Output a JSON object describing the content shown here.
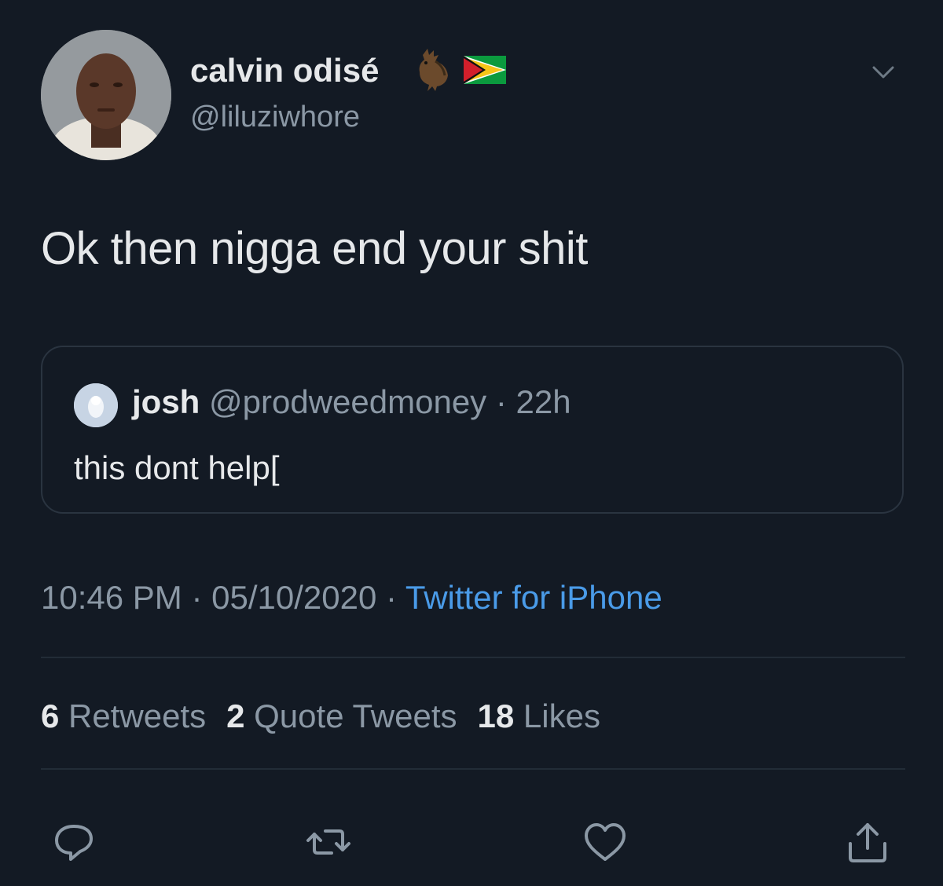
{
  "author": {
    "display_name": "calvin odisé",
    "handle": "@liluziwhore"
  },
  "tweet": {
    "text": "Ok then nigga end your shit"
  },
  "quoted_tweet": {
    "name": "josh",
    "meta": "@prodweedmoney · 22h",
    "text": "this dont help["
  },
  "timestamp": {
    "time_date": "10:46 PM · 05/10/2020 · ",
    "source": "Twitter for iPhone"
  },
  "stats": {
    "retweets_count": "6",
    "retweets_label": "Retweets",
    "quote_count": "2",
    "quote_label": "Quote Tweets",
    "likes_count": "18",
    "likes_label": "Likes"
  },
  "icons": {
    "reply": "reply-icon",
    "retweet": "retweet-icon",
    "like": "heart-icon",
    "share": "share-icon",
    "caret": "chevron-down-icon"
  },
  "colors": {
    "background": "#131a24",
    "link": "#4a9be8",
    "secondary_text": "#8b98a5"
  }
}
